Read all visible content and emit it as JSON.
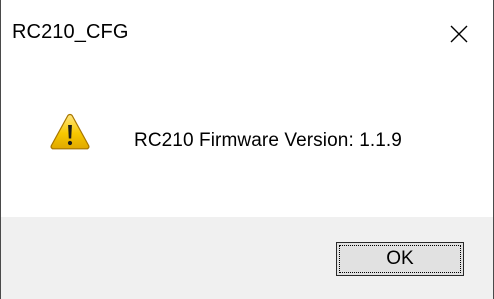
{
  "dialog": {
    "title": "RC210_CFG",
    "message": "RC210 Firmware Version: 1.1.9",
    "icon": "warning-icon",
    "close_icon": "close-icon",
    "ok_label": "OK"
  },
  "colors": {
    "title_bg": "#ffffff",
    "footer_bg": "#f0f0f0",
    "button_bg": "#e1e1e1",
    "warning_fill": "#f5c400",
    "warning_outline": "#b07d00",
    "text": "#000000"
  }
}
